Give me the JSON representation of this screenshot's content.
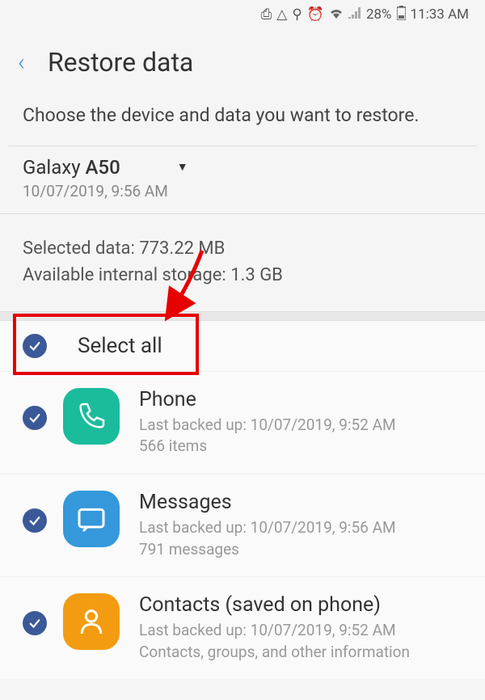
{
  "status_bar": {
    "battery": "28%",
    "time": "11:33 AM"
  },
  "header": {
    "title": "Restore data"
  },
  "instruction": "Choose the device and data you want to restore.",
  "device": {
    "name_prefix": "Galaxy ",
    "model": "A50",
    "date": "10/07/2019, 9:56 AM"
  },
  "data_info": {
    "selected_label": "Selected data: ",
    "selected_value": "773.22 MB",
    "available_label": "Available internal storage: ",
    "available_value": "1.3 GB"
  },
  "select_all": {
    "label": "Select all"
  },
  "items": [
    {
      "title": "Phone",
      "backup_line": "Last backed up: 10/07/2019, 9:52 AM",
      "count_line": "566 items"
    },
    {
      "title": "Messages",
      "backup_line": "Last backed up: 10/07/2019, 9:56 AM",
      "count_line": "791 messages"
    },
    {
      "title": "Contacts (saved on phone)",
      "backup_line": "Last backed up: 10/07/2019, 9:52 AM",
      "count_line": "Contacts, groups, and other information"
    }
  ]
}
